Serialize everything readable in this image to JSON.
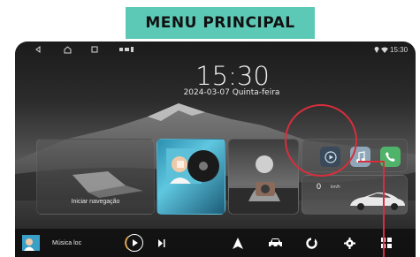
{
  "badge": {
    "title": "MENU PRINCIPAL"
  },
  "statusbar": {
    "time": "15:30"
  },
  "clock": {
    "time": "15:30",
    "date": "2024-03-07 Quinta-feira"
  },
  "cards": {
    "navigation_label": "Iniciar navegação",
    "speed_value": "0",
    "speed_unit": "km/h"
  },
  "dock": {
    "music_label": "Música loc"
  },
  "colors": {
    "badge": "#5cc9b6",
    "highlight": "#d72e3c",
    "phone_app": "#4fb36a"
  },
  "icons": [
    "back-icon",
    "home-icon",
    "recent-apps-icon",
    "location-icon",
    "wifi-icon",
    "video-app-icon",
    "music-app-icon",
    "phone-app-icon",
    "play-icon",
    "next-track-icon",
    "navigation-arrow-icon",
    "car-icon",
    "refresh-app-icon",
    "settings-icon",
    "apps-grid-icon"
  ]
}
